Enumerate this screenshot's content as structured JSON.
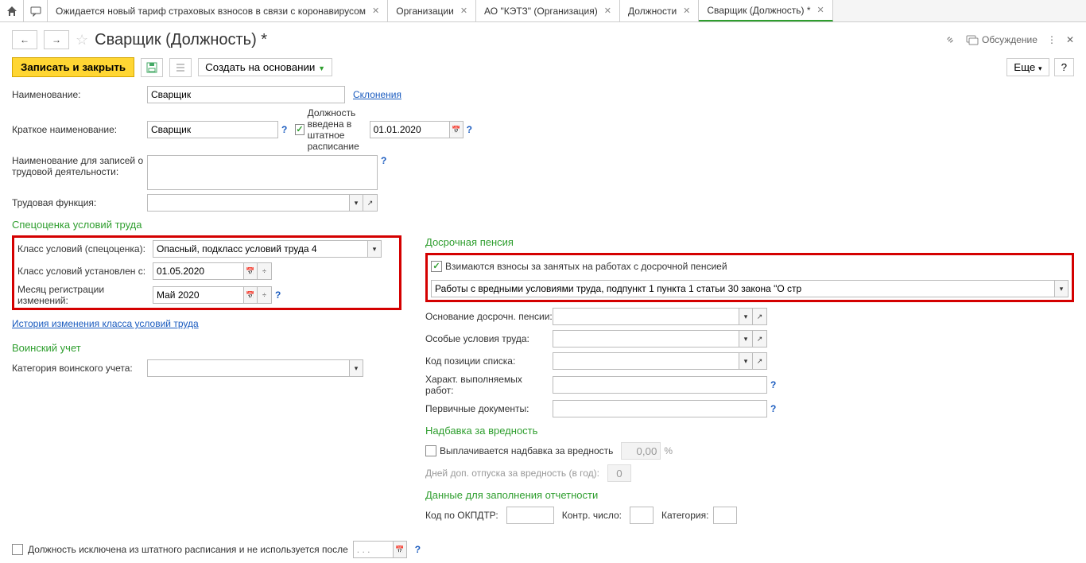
{
  "tabs": {
    "t1": "Ожидается новый тариф страховых взносов в связи с коронавирусом",
    "t2": "Организации",
    "t3": "АО \"КЭТЗ\" (Организация)",
    "t4": "Должности",
    "t5": "Сварщик (Должность) *"
  },
  "header": {
    "title": "Сварщик (Должность) *",
    "discuss": "Обсуждение"
  },
  "actions": {
    "save_close": "Записать и закрыть",
    "create_based": "Создать на основании",
    "more": "Еще",
    "help": "?"
  },
  "form": {
    "name_label": "Наименование:",
    "name_value": "Сварщик",
    "declension": "Склонения",
    "short_label": "Краткое наименование:",
    "short_value": "Сварщик",
    "staffing_label": "Должность введена в штатное расписание",
    "staffing_date": "01.01.2020",
    "empl_record_label": "Наименование для записей о трудовой деятельности:",
    "labor_func_label": "Трудовая функция:"
  },
  "spec": {
    "title": "Спецоценка условий труда",
    "class_label": "Класс условий (спецоценка):",
    "class_value": "Опасный, подкласс условий труда 4",
    "since_label": "Класс условий установлен с:",
    "since_value": "01.05.2020",
    "month_label": "Месяц регистрации изменений:",
    "month_value": "Май 2020",
    "history_link": "История изменения класса условий труда"
  },
  "military": {
    "title": "Воинский учет",
    "cat_label": "Категория воинского учета:"
  },
  "pension": {
    "title": "Досрочная пенсия",
    "cb_label": "Взимаются взносы за занятых на работах с досрочной пенсией",
    "select_value": "Работы с вредными условиями труда, подпункт 1 пункта 1 статьи 30 закона \"О стр",
    "basis_label": "Основание досрочн. пенсии:",
    "cond_label": "Особые условия труда:",
    "code_label": "Код позиции списка:",
    "char_label": "Характ. выполняемых работ:",
    "docs_label": "Первичные документы:"
  },
  "harm": {
    "title": "Надбавка за вредность",
    "cb_label": "Выплачивается надбавка за вредность",
    "pct_value": "0,00",
    "pct_unit": "%",
    "days_label": "Дней доп. отпуска за вредность (в год):",
    "days_value": "0"
  },
  "report": {
    "title": "Данные для заполнения отчетности",
    "okpdtr_label": "Код по ОКПДТР:",
    "control_label": "Контр. число:",
    "cat_label": "Категория:"
  },
  "footer": {
    "excluded_label": "Должность исключена из штатного расписания и не используется после",
    "date_placeholder": ". . ."
  }
}
